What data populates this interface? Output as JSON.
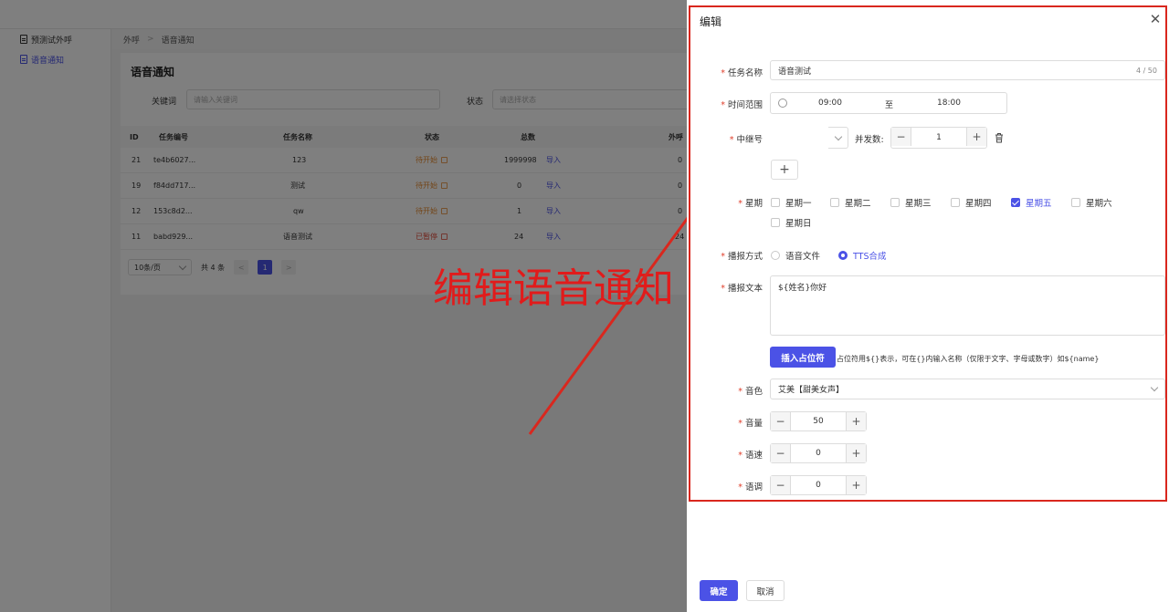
{
  "sidebar": {
    "items": [
      {
        "label": "预测试外呼",
        "active": false
      },
      {
        "label": "语音通知",
        "active": true
      }
    ]
  },
  "breadcrumb": {
    "items": [
      "外呼",
      "语音通知"
    ],
    "separator": ">"
  },
  "page": {
    "title": "语音通知",
    "filters": {
      "keyword_label": "关键词",
      "keyword_placeholder": "请输入关键词",
      "status_label": "状态",
      "status_placeholder": "请选择状态"
    }
  },
  "table": {
    "columns": [
      "ID",
      "任务编号",
      "任务名称",
      "状态",
      "总数",
      "外呼"
    ],
    "rows": [
      {
        "id": "21",
        "code": "te4b6027...",
        "name": "123",
        "status": "待开始",
        "total": "1999998",
        "action": "导入",
        "called": "0"
      },
      {
        "id": "19",
        "code": "f84dd717...",
        "name": "测试",
        "status": "待开始",
        "total": "0",
        "action": "导入",
        "called": "0"
      },
      {
        "id": "12",
        "code": "153c8d2...",
        "name": "qw",
        "status": "待开始",
        "total": "1",
        "action": "导入",
        "called": "0"
      },
      {
        "id": "11",
        "code": "babd929...",
        "name": "语音测试",
        "status": "已暂停",
        "total": "24",
        "action": "导入",
        "called": "24"
      }
    ]
  },
  "pagination": {
    "page_size": "10条/页",
    "total_text": "共 4 条",
    "current_page": "1",
    "prev": "<",
    "next": ">"
  },
  "annotation": {
    "text": "编辑语音通知",
    "color": "#e11b1b"
  },
  "drawer": {
    "title": "编辑",
    "close": "✕",
    "fields": {
      "task_name": {
        "label": "任务名称",
        "value": "语音测试",
        "count": "4 / 50"
      },
      "time_range": {
        "label": "时间范围",
        "start": "09:00",
        "sep": "至",
        "end": "18:00"
      },
      "relay": {
        "label": "中继号",
        "value": "",
        "concurrency_label": "并发数:",
        "concurrency": "1",
        "add": "+"
      },
      "weekday": {
        "label": "星期",
        "options": [
          {
            "label": "星期一",
            "checked": false
          },
          {
            "label": "星期二",
            "checked": false
          },
          {
            "label": "星期三",
            "checked": false
          },
          {
            "label": "星期四",
            "checked": false
          },
          {
            "label": "星期五",
            "checked": true
          },
          {
            "label": "星期六",
            "checked": false
          },
          {
            "label": "星期日",
            "checked": false
          }
        ]
      },
      "play_mode": {
        "label": "播报方式",
        "options": [
          {
            "label": "语音文件",
            "checked": false
          },
          {
            "label": "TTS合成",
            "checked": true
          }
        ]
      },
      "play_text": {
        "label": "播报文本",
        "value": "${姓名}你好",
        "insert_button": "插入占位符",
        "hint": "占位符用${}表示，可在{}内输入名称（仅限于文字、字母或数字）如${name}"
      },
      "voice": {
        "label": "音色",
        "value": "艾美【甜美女声】"
      },
      "volume": {
        "label": "音量",
        "value": "50"
      },
      "speed": {
        "label": "语速",
        "value": "0"
      },
      "pitch": {
        "label": "语调",
        "value": "0"
      }
    },
    "required_mark": "*",
    "footer": {
      "confirm": "确定",
      "cancel": "取消"
    }
  },
  "colors": {
    "primary": "#4b52e6",
    "annotation_red": "#d9271e",
    "pending": "#e68a2e",
    "paused": "#e04b3a"
  }
}
